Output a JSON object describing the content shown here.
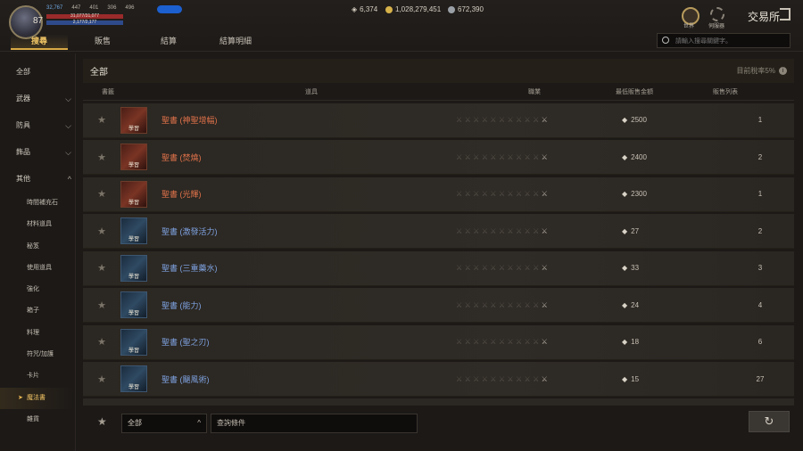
{
  "player": {
    "level": "87",
    "stats": [
      "32,767",
      "447",
      "401",
      "306",
      "496"
    ],
    "hp_text": "31,077/31,077",
    "mp_text": "2,177/2,177"
  },
  "currency": [
    {
      "icon": "diamond-icon",
      "value": "6,374"
    },
    {
      "icon": "gold-coin-icon",
      "value": "1,028,279,451"
    },
    {
      "icon": "silver-coin-icon",
      "value": "672,390"
    }
  ],
  "tabs": [
    "搜尋",
    "販售",
    "結算",
    "結算明細"
  ],
  "header": {
    "world_label": "世界",
    "server_label": "伺服器",
    "title": "交易所"
  },
  "search": {
    "placeholder": "請輸入搜尋關鍵字。"
  },
  "sidebar": {
    "categories": [
      "全部",
      "武器",
      "防具",
      "飾品",
      "其他"
    ],
    "sub_items": [
      "時間補充石",
      "材料道具",
      "秘笈",
      "使用道具",
      "強化",
      "箱子",
      "料理",
      "符咒/加護",
      "卡片",
      "魔法書",
      "雜貨"
    ]
  },
  "main": {
    "section_label": "全部",
    "tax_label": "目前稅率5%",
    "columns": {
      "fav": "書籤",
      "item": "道具",
      "class": "職業",
      "min_price": "最低販售金額",
      "count": "販售列表"
    }
  },
  "items": [
    {
      "name": "聖書 (神聖增幅)",
      "grade": "red",
      "price": "2500",
      "count": "1"
    },
    {
      "name": "聖書 (焚燒)",
      "grade": "red",
      "price": "2400",
      "count": "2"
    },
    {
      "name": "聖書 (光輝)",
      "grade": "red",
      "price": "2300",
      "count": "1"
    },
    {
      "name": "聖書 (激發活力)",
      "grade": "blue",
      "price": "27",
      "count": "2"
    },
    {
      "name": "聖書 (三重藥水)",
      "grade": "blue",
      "price": "33",
      "count": "3"
    },
    {
      "name": "聖書 (能力)",
      "grade": "blue",
      "price": "24",
      "count": "4"
    },
    {
      "name": "聖書 (聖之刃)",
      "grade": "blue",
      "price": "18",
      "count": "6"
    },
    {
      "name": "聖書 (颶風術)",
      "grade": "blue",
      "price": "15",
      "count": "27"
    }
  ],
  "item_icon_label": "學習",
  "bottom": {
    "filter_select": "全部",
    "query_label": "查詢條件"
  }
}
